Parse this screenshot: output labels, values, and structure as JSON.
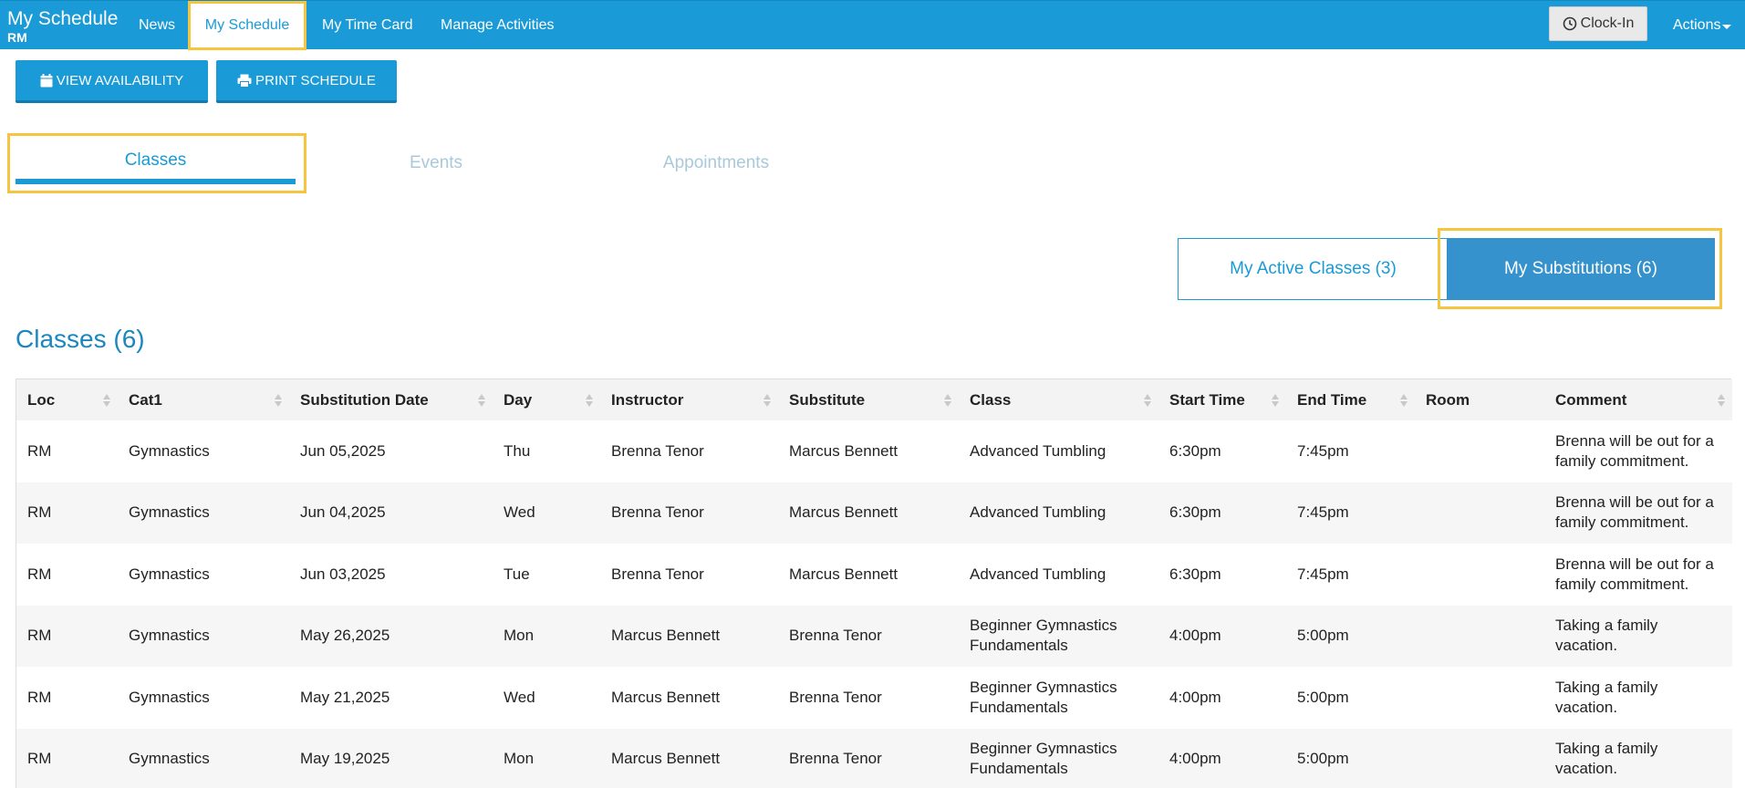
{
  "header": {
    "title": "My Schedule",
    "subtitle": "RM",
    "nav": [
      "News",
      "My Schedule",
      "My Time Card",
      "Manage Activities"
    ],
    "clock_in_label": "Clock-In",
    "actions_label": "Actions"
  },
  "toolbar": {
    "view_availability": "VIEW AVAILABILITY",
    "print_schedule": "PRINT SCHEDULE"
  },
  "tabs": [
    "Classes",
    "Events",
    "Appointments"
  ],
  "toggle": {
    "active_classes": "My Active Classes (3)",
    "substitutions": "My Substitutions (6)"
  },
  "section_title": "Classes (6)",
  "table": {
    "columns": [
      "Loc",
      "Cat1",
      "Substitution Date",
      "Day",
      "Instructor",
      "Substitute",
      "Class",
      "Start Time",
      "End Time",
      "Room",
      "Comment"
    ],
    "rows": [
      [
        "RM",
        "Gymnastics",
        "Jun 05,2025",
        "Thu",
        "Brenna Tenor",
        "Marcus Bennett",
        "Advanced Tumbling",
        "6:30pm",
        "7:45pm",
        "",
        "Brenna will be out for a family commitment."
      ],
      [
        "RM",
        "Gymnastics",
        "Jun 04,2025",
        "Wed",
        "Brenna Tenor",
        "Marcus Bennett",
        "Advanced Tumbling",
        "6:30pm",
        "7:45pm",
        "",
        "Brenna will be out for a family commitment."
      ],
      [
        "RM",
        "Gymnastics",
        "Jun 03,2025",
        "Tue",
        "Brenna Tenor",
        "Marcus Bennett",
        "Advanced Tumbling",
        "6:30pm",
        "7:45pm",
        "",
        "Brenna will be out for a family commitment."
      ],
      [
        "RM",
        "Gymnastics",
        "May 26,2025",
        "Mon",
        "Marcus Bennett",
        "Brenna Tenor",
        "Beginner Gymnastics Fundamentals",
        "4:00pm",
        "5:00pm",
        "",
        "Taking a family vacation."
      ],
      [
        "RM",
        "Gymnastics",
        "May 21,2025",
        "Wed",
        "Marcus Bennett",
        "Brenna Tenor",
        "Beginner Gymnastics Fundamentals",
        "4:00pm",
        "5:00pm",
        "",
        "Taking a family vacation."
      ],
      [
        "RM",
        "Gymnastics",
        "May 19,2025",
        "Mon",
        "Marcus Bennett",
        "Brenna Tenor",
        "Beginner Gymnastics Fundamentals",
        "4:00pm",
        "5:00pm",
        "",
        "Taking a family vacation."
      ]
    ]
  },
  "colors": {
    "brand": "#1a9ad6",
    "highlight": "#f6c540",
    "toggle_active": "#3592cc"
  },
  "icons": [
    "clock-icon",
    "calendar-icon",
    "printer-icon",
    "chevron-down-icon",
    "sort-icon"
  ]
}
